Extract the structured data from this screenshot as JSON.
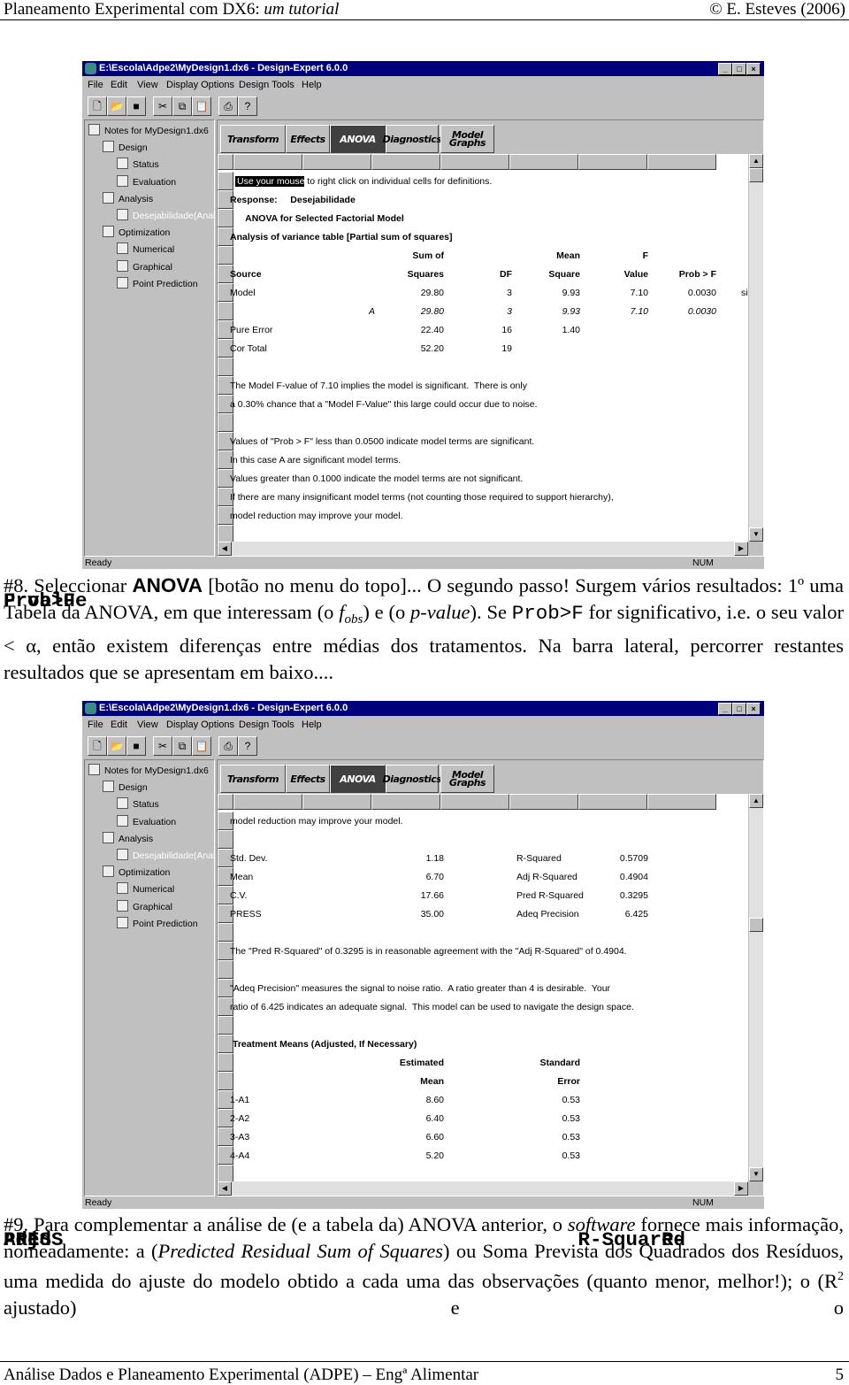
{
  "header": {
    "title": "Planeamento Experimental com DX6: ",
    "title_italic": "um tutorial",
    "author": "© E. Esteves (2006)"
  },
  "footer": {
    "text": "Análise Dados e Planeamento Experimental (ADPE) – Engª Alimentar",
    "page": "5"
  },
  "colors": {
    "titlebar": "#00007e",
    "window_gray": "#c0c0c0",
    "selected_tab": "#404040"
  },
  "windows": [
    {
      "title": "E:\\Escola\\Adpe2\\MyDesign1.dx6 - Design-Expert 6.0.0",
      "menu": [
        "File",
        "Edit",
        "View",
        "Display Options",
        "Design Tools",
        "Help"
      ],
      "toolbar_icons": [
        "new-icon",
        "open-icon",
        "save-icon",
        "cut-icon",
        "copy-icon",
        "paste-icon",
        "print-icon",
        "help-icon"
      ],
      "tree": [
        "Notes for MyDesign1.dx6",
        "Design",
        "Status",
        "Evaluation",
        "Analysis",
        "Desejabilidade(Anal",
        "Optimization",
        "Numerical",
        "Graphical",
        "Point Prediction"
      ],
      "tabs": [
        "Transform",
        "Effects",
        "ANOVA",
        "Diagnostics",
        "Model Graphs"
      ],
      "selected_tab": "ANOVA",
      "status": {
        "left": "Ready",
        "right": "NUM"
      },
      "rows": [
        {
          "cells": [
            "Use your mouse",
            " to right click on individual cells for definitions."
          ],
          "style": "highlight"
        },
        {
          "cells": [
            "Response:     Desejabilidade"
          ],
          "style": "bold"
        },
        {
          "cells": [
            "      ANOVA for Selected Factorial Model"
          ],
          "style": "bold"
        },
        {
          "cells": [
            "Analysis of variance table [Partial sum of squares]"
          ],
          "style": "bold"
        },
        {
          "cells": [
            "",
            "Sum of",
            "",
            "Mean",
            "F"
          ],
          "style": "bold"
        },
        {
          "cells": [
            "Source",
            "Squares",
            "DF",
            "Square",
            "Value",
            "Prob > F"
          ],
          "style": "bold"
        },
        {
          "cells": [
            "Model",
            "29.80",
            "3",
            "9.93",
            "7.10",
            "0.0030",
            "significant"
          ]
        },
        {
          "cells": [
            "",
            "29.80",
            "3",
            "9.93",
            "7.10",
            "0.0030",
            "",
            "A"
          ],
          "style": "italic"
        },
        {
          "cells": [
            "Pure Error",
            "22.40",
            "16",
            "1.40"
          ]
        },
        {
          "cells": [
            "Cor Total",
            "52.20",
            "19"
          ]
        },
        {
          "cells": []
        },
        {
          "cells": [
            "The Model F-value of 7.10 implies the model is significant.  There is only"
          ]
        },
        {
          "cells": [
            "a 0.30% chance that a \"Model F-Value\" this large could occur due to noise."
          ]
        },
        {
          "cells": []
        },
        {
          "cells": [
            "Values of \"Prob > F\" less than 0.0500 indicate model terms are significant."
          ]
        },
        {
          "cells": [
            "In this case A are significant model terms."
          ]
        },
        {
          "cells": [
            "Values greater than 0.1000 indicate the model terms are not significant."
          ]
        },
        {
          "cells": [
            "If there are many insignificant model terms (not counting those required to support hierarchy),"
          ]
        },
        {
          "cells": [
            "model reduction may improve your model."
          ]
        }
      ]
    },
    {
      "title": "E:\\Escola\\Adpe2\\MyDesign1.dx6 - Design-Expert 6.0.0",
      "menu": [
        "File",
        "Edit",
        "View",
        "Display Options",
        "Design Tools",
        "Help"
      ],
      "toolbar_icons": [
        "new-icon",
        "open-icon",
        "save-icon",
        "cut-icon",
        "copy-icon",
        "paste-icon",
        "print-icon",
        "help-icon"
      ],
      "tree": [
        "Notes for MyDesign1.dx6",
        "Design",
        "Status",
        "Evaluation",
        "Analysis",
        "Desejabilidade(Anal",
        "Optimization",
        "Numerical",
        "Graphical",
        "Point Prediction"
      ],
      "tabs": [
        "Transform",
        "Effects",
        "ANOVA",
        "Diagnostics",
        "Model Graphs"
      ],
      "selected_tab": "ANOVA",
      "status": {
        "left": "Ready",
        "right": "NUM"
      },
      "rows": [
        {
          "cells": [
            "model reduction may improve your model."
          ]
        },
        {
          "cells": []
        },
        {
          "cells": [
            "Std. Dev.",
            "1.18",
            "R-Squared",
            "0.5709"
          ]
        },
        {
          "cells": [
            "Mean",
            "6.70",
            "Adj R-Squared",
            "0.4904"
          ]
        },
        {
          "cells": [
            "C.V.",
            "17.66",
            "Pred R-Squared",
            "0.3295"
          ]
        },
        {
          "cells": [
            "PRESS",
            "35.00",
            "Adeq Precision",
            "6.425"
          ]
        },
        {
          "cells": []
        },
        {
          "cells": [
            "The \"Pred R-Squared\" of 0.3295 is in reasonable agreement with the \"Adj R-Squared\" of 0.4904."
          ]
        },
        {
          "cells": []
        },
        {
          "cells": [
            "\"Adeq Precision\" measures the signal to noise ratio.  A ratio greater than 4 is desirable.  Your"
          ]
        },
        {
          "cells": [
            "ratio of 6.425 indicates an adequate signal.  This model can be used to navigate the design space."
          ]
        },
        {
          "cells": []
        },
        {
          "cells": [
            "",
            "",
            "",
            "",
            "",
            "Treatment Means (Adjusted, If Necessary)"
          ],
          "style": "bold"
        },
        {
          "cells": [
            "",
            "Estimated",
            "",
            "",
            "Standard"
          ],
          "style": "bold"
        },
        {
          "cells": [
            "",
            "Mean",
            "",
            "",
            "Error"
          ],
          "style": "bold"
        },
        {
          "cells": [
            "1-A1",
            "8.60",
            "",
            "",
            "0.53"
          ]
        },
        {
          "cells": [
            "2-A2",
            "6.40",
            "",
            "",
            "0.53"
          ]
        },
        {
          "cells": [
            "3-A3",
            "6.60",
            "",
            "",
            "0.53"
          ]
        },
        {
          "cells": [
            "4-A4",
            "5.20",
            "",
            "",
            "0.53"
          ]
        }
      ]
    }
  ],
  "paragraphs": [
    [
      {
        "t": "#8. Seleccionar ",
        "s": ""
      },
      {
        "t": "ANOVA",
        "s": "b"
      },
      {
        "t": " [botão no menu do topo]... O segundo passo! Surgem vários resultados: 1º uma Tabela da ANOVA, em que interessam ",
        "s": ""
      },
      {
        "t": "F value",
        "s": "mb"
      },
      {
        "t": " (o ",
        "s": ""
      },
      {
        "t": "f",
        "s": "i"
      },
      {
        "t": "obs",
        "s": "sub"
      },
      {
        "t": ") e ",
        "s": ""
      },
      {
        "t": "Prob>F",
        "s": "mb"
      },
      {
        "t": " (o ",
        "s": ""
      },
      {
        "t": "p-value",
        "s": "i"
      },
      {
        "t": "). Se ",
        "s": ""
      },
      {
        "t": "Prob>F",
        "s": "m"
      },
      {
        "t": " for significativo, i.e. o seu valor < α, então existem diferenças entre médias dos tratamentos. Na barra lateral, percorrer restantes resultados que se apresentam em baixo....",
        "s": ""
      }
    ],
    [
      {
        "t": "#9. Para complementar a análise de (e a tabela da) ANOVA anterior, o ",
        "s": ""
      },
      {
        "t": "software",
        "s": "i"
      },
      {
        "t": " fornece mais informação, nomeadamente: a ",
        "s": ""
      },
      {
        "t": "PRESS",
        "s": "mb"
      },
      {
        "t": " (",
        "s": ""
      },
      {
        "t": "Predicted Residual Sum of Squares",
        "s": "i"
      },
      {
        "t": ") ou Soma Prevista dos Quadrados dos Resíduos, uma medida do ajuste do modelo obtido a cada uma das observações (quanto menor, melhor!); o ",
        "s": ""
      },
      {
        "t": "Adj R-Squared",
        "s": "mb"
      },
      {
        "t": " (R",
        "s": ""
      },
      {
        "t": "2",
        "s": "sup"
      },
      {
        "t": " ajustado) e o ",
        "s": ""
      },
      {
        "t": "Pred R-",
        "s": "mb"
      }
    ]
  ]
}
